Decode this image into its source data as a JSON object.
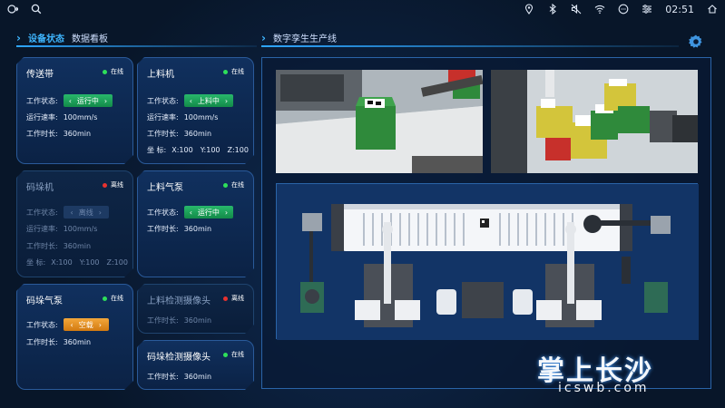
{
  "statusbar": {
    "time": "02:51"
  },
  "left_header": {
    "tab_active": "设备状态",
    "tab_inactive": "数据看板"
  },
  "right_header": {
    "title": "数字孪生生产线"
  },
  "labels": {
    "state": "工作状态:",
    "speed": "运行速率:",
    "duration": "工作时长:",
    "coord": "坐      标:"
  },
  "cards": {
    "conveyor": {
      "title": "传送带",
      "status": "在线",
      "state": "运行中",
      "speed": "100mm/s",
      "duration": "360min"
    },
    "loader": {
      "title": "上料机",
      "status": "在线",
      "state": "上料中",
      "speed": "100mm/s",
      "duration": "360min",
      "x": "X:100",
      "y": "Y:100",
      "z": "Z:100"
    },
    "stacker": {
      "title": "码垛机",
      "status": "离线",
      "state": "离线",
      "speed": "100mm/s",
      "duration": "360min",
      "x": "X:100",
      "y": "Y:100",
      "z": "Z:100"
    },
    "loader_pump": {
      "title": "上料气泵",
      "status": "在线",
      "state": "运行中",
      "duration": "360min"
    },
    "stacker_pump": {
      "title": "码垛气泵",
      "status": "在线",
      "state": "空载",
      "duration": "360min"
    },
    "loader_camera": {
      "title": "上料检测摄像头",
      "status": "离线",
      "duration": "360min"
    },
    "stacker_camera": {
      "title": "码垛检测摄像头",
      "status": "在线",
      "duration": "360min"
    }
  },
  "watermark": {
    "text": "掌上长沙",
    "url": "icswb.com"
  },
  "colors": {
    "online": "#2ee05a",
    "offline": "#e8322f",
    "accent": "#2ea6ff"
  }
}
